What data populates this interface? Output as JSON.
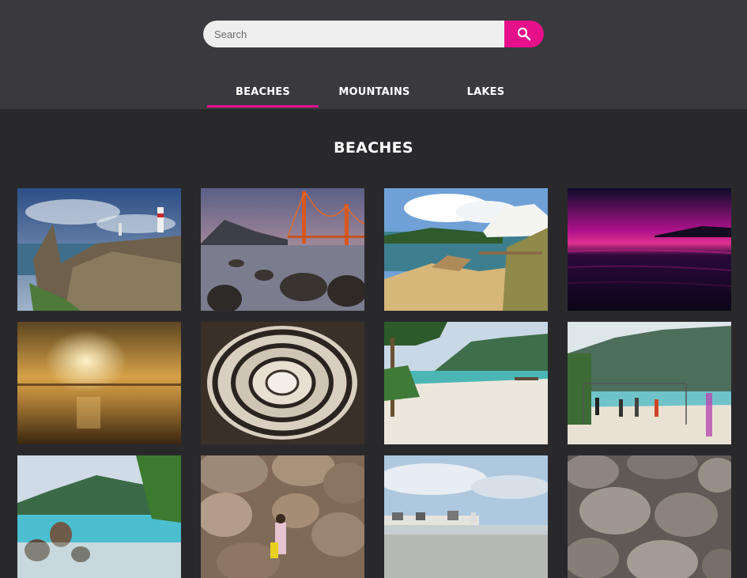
{
  "search": {
    "placeholder": "Search",
    "value": "",
    "button_icon": "search-icon",
    "accent_color": "#e6108a"
  },
  "tabs": [
    {
      "label": "BEACHES",
      "active": true
    },
    {
      "label": "MOUNTAINS",
      "active": false
    },
    {
      "label": "LAKES",
      "active": false
    }
  ],
  "section": {
    "title": "BEACHES"
  },
  "gallery": {
    "images": [
      {
        "subject": "lighthouse-on-rocky-coast"
      },
      {
        "subject": "golden-gate-bridge-at-dusk"
      },
      {
        "subject": "white-resort-above-sandy-cove"
      },
      {
        "subject": "magenta-sunset-over-sea"
      },
      {
        "subject": "golden-sunset-over-beach"
      },
      {
        "subject": "spiral-staircase-from-above"
      },
      {
        "subject": "palm-beach-with-boats"
      },
      {
        "subject": "beach-volleyball-game"
      },
      {
        "subject": "tropical-island-with-rocks"
      },
      {
        "subject": "boulders-with-person"
      },
      {
        "subject": "seaside-town-harbor"
      },
      {
        "subject": "granite-rock-formations"
      }
    ]
  }
}
